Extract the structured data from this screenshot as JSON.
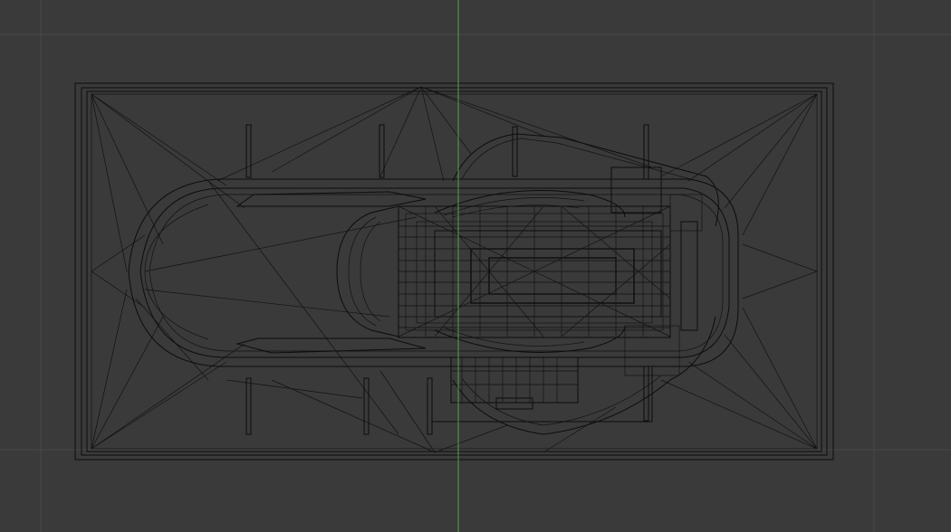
{
  "viewport": {
    "mode": "wireframe",
    "view": "top",
    "background_color": "#3a3a3a",
    "grid_color": "#484848",
    "y_axis_color": "#4ca64c",
    "wire_color": "#0c0c0c",
    "object": "vehicle-model"
  }
}
